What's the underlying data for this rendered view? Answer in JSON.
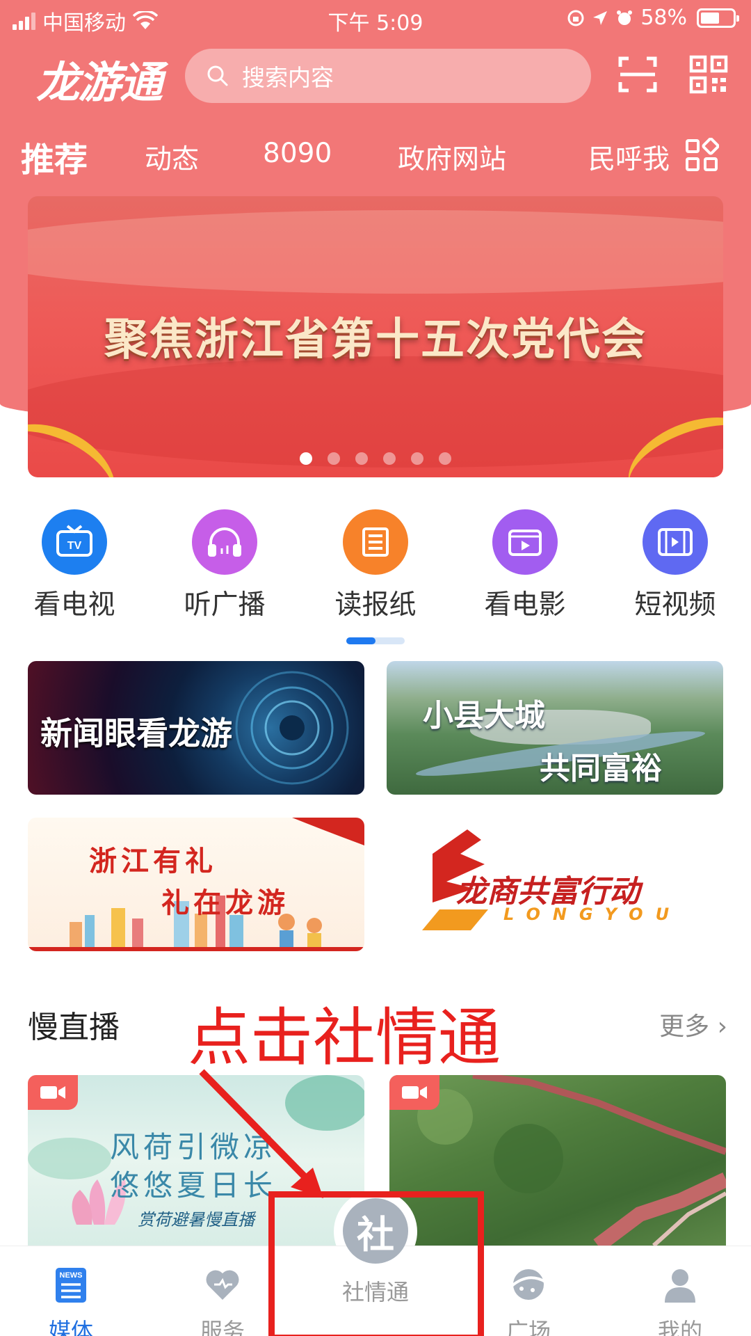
{
  "status_bar": {
    "carrier": "中国移动",
    "time": "下午 5:09",
    "battery_percent": "58%",
    "battery_level": 0.58
  },
  "header": {
    "logo_text": "龙游通",
    "search_placeholder": "搜索内容"
  },
  "tabs": [
    {
      "label": "推荐",
      "active": true
    },
    {
      "label": "动态",
      "active": false
    },
    {
      "label": "8090",
      "active": false
    },
    {
      "label": "政府网站",
      "active": false
    },
    {
      "label": "民呼我",
      "active": false
    }
  ],
  "banner": {
    "title": "聚焦浙江省第十五次党代会",
    "slide_count": 6,
    "active_slide": 1
  },
  "quick_actions": [
    {
      "label": "看电视",
      "icon": "tv-icon",
      "color": "#1d7ff0"
    },
    {
      "label": "听广播",
      "icon": "headphones-icon",
      "color": "#c65ee8"
    },
    {
      "label": "读报纸",
      "icon": "newspaper-icon",
      "color": "#f7822a"
    },
    {
      "label": "看电影",
      "icon": "film-icon",
      "color": "#a25df0"
    },
    {
      "label": "短视频",
      "icon": "video-icon",
      "color": "#5f69f2"
    }
  ],
  "feature_cards": [
    {
      "title": "新闻眼看龙游"
    },
    {
      "title": "小县大城",
      "subtitle": "共同富裕"
    },
    {
      "title": "浙江有礼",
      "subtitle": "礼在龙游"
    },
    {
      "title": "龙商共富行动",
      "subtitle": "LONGYOU"
    }
  ],
  "slow_live": {
    "section_title": "慢直播",
    "more_label": "更多",
    "items": [
      {
        "line1": "风荷引微凉",
        "line2": "悠悠夏日长",
        "caption": "赏荷避暑慢直播"
      },
      {
        "line1": "",
        "line2": "",
        "caption": ""
      }
    ]
  },
  "annotation": {
    "text": "点击社情通",
    "color": "#e8211e"
  },
  "tab_bar": [
    {
      "label": "媒体",
      "icon": "news-icon",
      "active": true
    },
    {
      "label": "服务",
      "icon": "heart-icon",
      "active": false
    },
    {
      "label": "社情通",
      "icon": "she-icon",
      "center_glyph": "社",
      "active": false
    },
    {
      "label": "广场",
      "icon": "plaza-icon",
      "active": false
    },
    {
      "label": "我的",
      "icon": "user-icon",
      "active": false
    }
  ],
  "colors": {
    "brand_red": "#f27777",
    "active_blue": "#1f6fe0",
    "inactive_gray": "#999999"
  }
}
